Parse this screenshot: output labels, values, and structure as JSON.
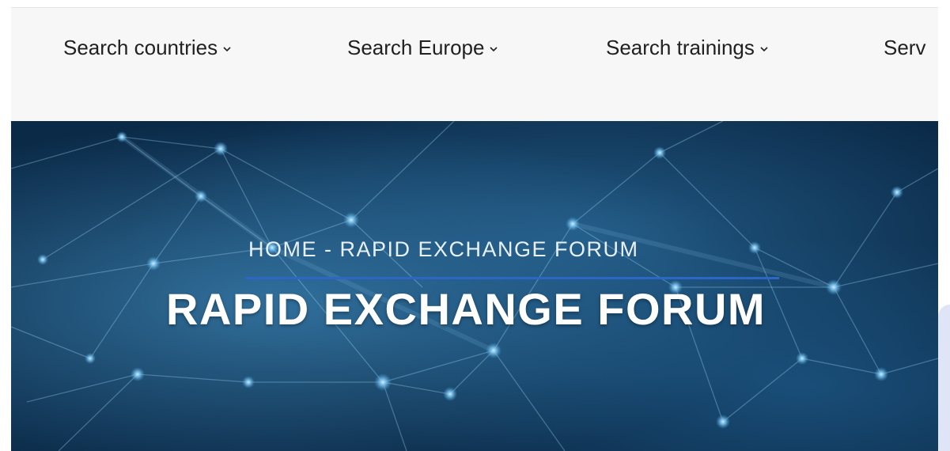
{
  "navbar": {
    "items": [
      {
        "label": "Search countries"
      },
      {
        "label": "Search Europe"
      },
      {
        "label": "Search trainings"
      },
      {
        "label": "Serv"
      }
    ]
  },
  "hero": {
    "breadcrumb": {
      "home": "HOME",
      "separator": " - ",
      "current": "RAPID EXCHANGE FORUM"
    },
    "title": "RAPID EXCHANGE FORUM"
  },
  "colors": {
    "navbar_bg": "#f7f7f7",
    "nav_text": "#212121",
    "hero_bg": "#0c2d4e",
    "accent_underline": "#2c67c8",
    "hero_text": "#ffffff",
    "side_tab": "#dfe4f6"
  },
  "icons": {
    "nav_dropdown": "chevron-down-icon"
  }
}
